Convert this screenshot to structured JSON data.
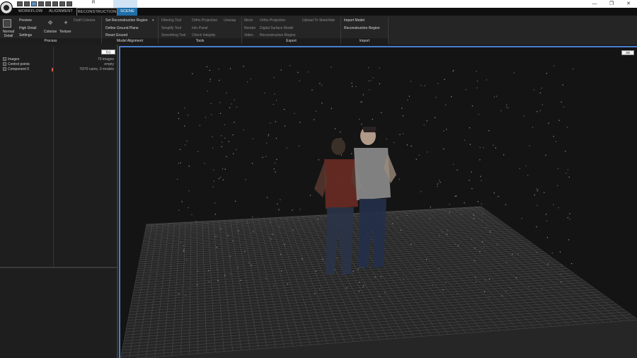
{
  "titlebar": {
    "title": "R",
    "minimize": "—",
    "maximize": "❐",
    "close": "✕"
  },
  "tabs": [
    {
      "label": "WORKFLOW",
      "active": false
    },
    {
      "label": "ALIGNMENT",
      "active": false
    },
    {
      "label": "RECONSTRUCTION",
      "active": false
    },
    {
      "label": "SCENE",
      "active": true
    }
  ],
  "user_badge": "RC",
  "ribbon": {
    "process": {
      "normal_detail": "Normal Detail",
      "preview": "Preview",
      "high_detail": "High Detail",
      "settings": "Settings",
      "colorize": "Colorize",
      "texture": "Texture",
      "draft_colorize": "Draft Colorize",
      "group_label": "Process"
    },
    "model_alignment": {
      "set_recon_region": "Set Reconstruction Region",
      "define_ground_plane": "Define Ground Plane",
      "reset_ground": "Reset Ground",
      "group_label": "Model Alignment"
    },
    "tools": {
      "filtering_tool": "Filtering Tool",
      "simplify_tool": "Simplify Tool",
      "smoothing_tool": "Smoothing Tool",
      "ortho_projection": "Ortho Projection",
      "unwrap": "Unwrap",
      "info_panel": "Info Panel",
      "check_integrity": "Check Integrity",
      "group_label": "Tools"
    },
    "export": {
      "mesh": "Mesh",
      "render": "Render",
      "video": "Video",
      "ortho_projection": "Ortho Projection",
      "digital_surface_model": "Digital Surface Model",
      "reconstruction_region": "Reconstruction Region",
      "upload_sketchfab": "Upload To Sketchfab",
      "group_label": "Export"
    },
    "import": {
      "import_model": "Import Model",
      "reconstruction_region": "Reconstruction Region",
      "group_label": "Import"
    }
  },
  "left_panel": {
    "filter_label": "f(x)",
    "tree": [
      {
        "label": "Images",
        "value": "70 images"
      },
      {
        "label": "Control points",
        "value": "empty"
      },
      {
        "label": "Component 0",
        "value": "70/70 cams, 0 models"
      }
    ]
  },
  "viewport": {
    "mode_badge": "3D"
  },
  "colors": {
    "accent": "#1f6ea8",
    "viewport_border": "#4a7fd0",
    "grid": "#5a5a5a"
  }
}
